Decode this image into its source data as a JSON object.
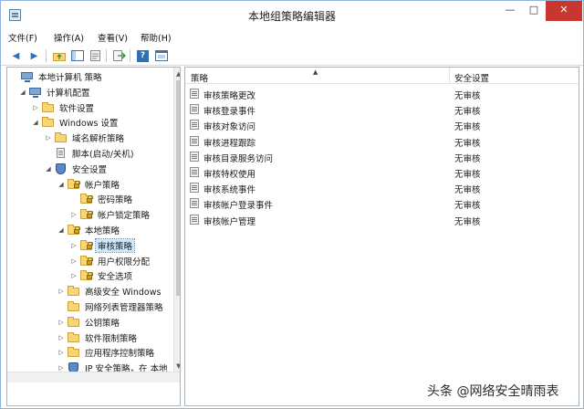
{
  "window": {
    "title": "本地组策略编辑器"
  },
  "title_buttons": {
    "minimize": "—",
    "maximize": "□",
    "close": "✕"
  },
  "menu": [
    "文件(F)",
    "操作(A)",
    "查看(V)",
    "帮助(H)"
  ],
  "toolbar": {
    "back": "◀",
    "forward": "▶",
    "help": "?"
  },
  "tree": {
    "items": [
      {
        "label": "本地计算机 策略",
        "expander": "",
        "icon": "computer-icon"
      },
      {
        "label": "计算机配置",
        "expander": "◢",
        "icon": "computer-icon"
      },
      {
        "label": "软件设置",
        "expander": "▷",
        "icon": "folder-icon"
      },
      {
        "label": "Windows 设置",
        "expander": "◢",
        "icon": "folder-icon"
      },
      {
        "label": "域名解析策略",
        "expander": "▷",
        "icon": "folder-icon"
      },
      {
        "label": "脚本(启动/关机)",
        "expander": "",
        "icon": "script-icon"
      },
      {
        "label": "安全设置",
        "expander": "◢",
        "icon": "shield-icon"
      },
      {
        "label": "帐户策略",
        "expander": "◢",
        "icon": "locked-folder-icon"
      },
      {
        "label": "密码策略",
        "expander": "",
        "icon": "locked-folder-icon"
      },
      {
        "label": "帐户锁定策略",
        "expander": "▷",
        "icon": "locked-folder-icon"
      },
      {
        "label": "本地策略",
        "expander": "◢",
        "icon": "locked-folder-icon"
      },
      {
        "label": "审核策略",
        "expander": "▷",
        "icon": "locked-folder-icon"
      },
      {
        "label": "用户权限分配",
        "expander": "▷",
        "icon": "locked-folder-icon"
      },
      {
        "label": "安全选项",
        "expander": "▷",
        "icon": "locked-folder-icon"
      },
      {
        "label": "高级安全 Windows",
        "expander": "▷",
        "icon": "folder-icon"
      },
      {
        "label": "网络列表管理器策略",
        "expander": "",
        "icon": "folder-icon"
      },
      {
        "label": "公钥策略",
        "expander": "▷",
        "icon": "folder-icon"
      },
      {
        "label": "软件限制策略",
        "expander": "▷",
        "icon": "folder-icon"
      },
      {
        "label": "应用程序控制策略",
        "expander": "▷",
        "icon": "folder-icon"
      },
      {
        "label": "IP 安全策略，在 本地",
        "expander": "▷",
        "icon": "shield-icon"
      }
    ],
    "selected_label": "审核策略"
  },
  "list": {
    "columns": [
      "策略",
      "安全设置"
    ],
    "sort_arrow": "▲",
    "rows": [
      {
        "policy": "审核策略更改",
        "setting": "无审核"
      },
      {
        "policy": "审核登录事件",
        "setting": "无审核"
      },
      {
        "policy": "审核对象访问",
        "setting": "无审核"
      },
      {
        "policy": "审核进程跟踪",
        "setting": "无审核"
      },
      {
        "policy": "审核目录服务访问",
        "setting": "无审核"
      },
      {
        "policy": "审核特权使用",
        "setting": "无审核"
      },
      {
        "policy": "审核系统事件",
        "setting": "无审核"
      },
      {
        "policy": "审核帐户登录事件",
        "setting": "无审核"
      },
      {
        "policy": "审核帐户管理",
        "setting": "无审核"
      }
    ]
  },
  "scroll_arrows": {
    "up": "▲",
    "down": "▼"
  },
  "watermark": "头条 @网络安全晴雨表",
  "colors": {
    "selection": "#cce8ff",
    "close_button": "#c7372f",
    "folder": "#f6d676"
  }
}
